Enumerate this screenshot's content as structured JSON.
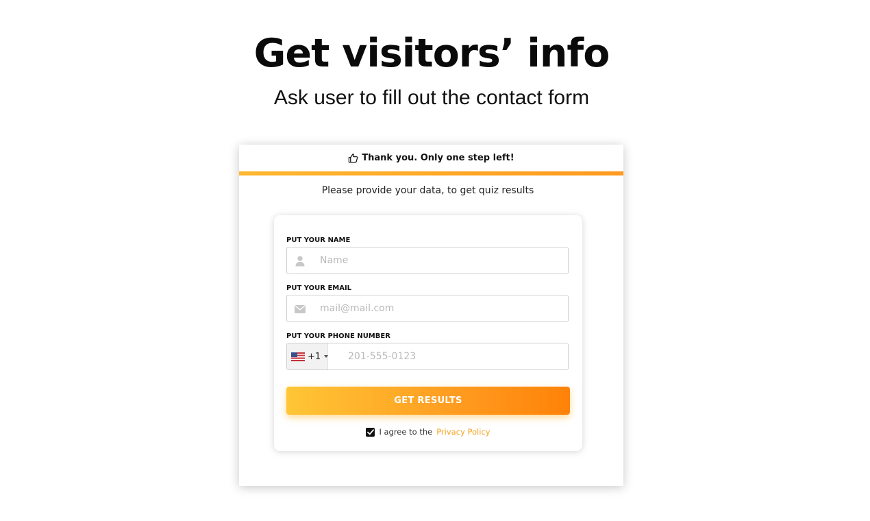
{
  "page": {
    "headline": "Get visitors’ info",
    "subheadline": "Ask user to fill out the contact form"
  },
  "quiz_card": {
    "header_icon": "thumbs-up-icon",
    "header_text": "Thank you. Only one step left!",
    "progress_percent": 100,
    "intro_text": "Please provide your data, to get quiz results",
    "colors": {
      "accent": "#ff9a1e",
      "accent_light": "#ffc636",
      "link": "#f5a623",
      "icon_gray": "#c8c8c8"
    },
    "form": {
      "name": {
        "label": "PUT YOUR NAME",
        "placeholder": "Name",
        "icon": "user-icon"
      },
      "email": {
        "label": "PUT YOUR EMAIL",
        "placeholder": "mail@mail.com",
        "icon": "envelope-icon"
      },
      "phone": {
        "label": "PUT YOUR PHONE NUMBER",
        "country_flag": "us-flag-icon",
        "dial_code": "+1",
        "placeholder": "201-555-0123"
      },
      "submit_label": "GET RESULTS",
      "consent": {
        "checked": true,
        "text": "I agree to the",
        "link_text": "Privacy Policy"
      }
    }
  }
}
